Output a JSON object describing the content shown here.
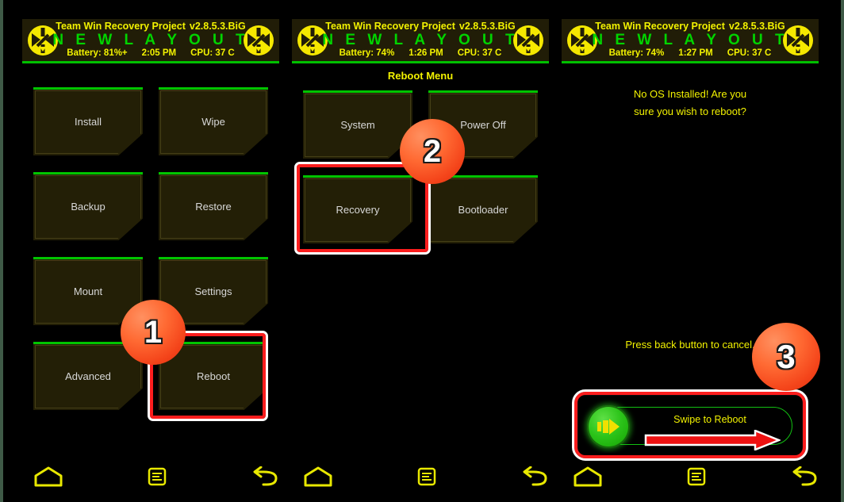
{
  "colors": {
    "background": "#000000",
    "button_fill": "#231f06",
    "button_top_border": "#00c400",
    "header_bg": "#211d07",
    "accent_yellow": "#f2f200",
    "accent_green": "#00d400",
    "highlight_red": "#fb1d1d",
    "highlight_white": "#ffffff",
    "badge_orange": "#ff6a33",
    "nav_icon_yellow": "#e8e800",
    "edge_rail": "#3f5a47"
  },
  "panels": [
    {
      "id": "panel-main-menu",
      "header": {
        "title": "Team Win Recovery Project",
        "version": "v2.8.5.3.BiG",
        "layout_banner": "N E W   L A Y O U T",
        "battery": "Battery: 81%+",
        "time": "2:05 PM",
        "cpu": "CPU: 37 C",
        "logo_left": "twrp-logo-icon",
        "logo_right": "twrp-logo-icon"
      },
      "menu_label": "",
      "buttons": [
        "Install",
        "Wipe",
        "Backup",
        "Restore",
        "Mount",
        "Settings",
        "Advanced",
        "Reboot"
      ],
      "nav": [
        "home-icon",
        "menu-icon",
        "back-icon"
      ]
    },
    {
      "id": "panel-reboot-menu",
      "header": {
        "title": "Team Win Recovery Project",
        "version": "v2.8.5.3.BiG",
        "layout_banner": "N E W   L A Y O U T",
        "battery": "Battery: 74%",
        "time": "1:26 PM",
        "cpu": "CPU: 37 C",
        "logo_left": "twrp-logo-icon",
        "logo_right": "twrp-logo-icon"
      },
      "menu_label": "Reboot Menu",
      "buttons": [
        "System",
        "Power Off",
        "Recovery",
        "Bootloader"
      ],
      "nav": [
        "home-icon",
        "menu-icon",
        "back-icon"
      ]
    },
    {
      "id": "panel-reboot-confirm",
      "header": {
        "title": "Team Win Recovery Project",
        "version": "v2.8.5.3.BiG",
        "layout_banner": "N E W   L A Y O U T",
        "battery": "Battery: 74%",
        "time": "1:27 PM",
        "cpu": "CPU: 37 C",
        "logo_left": "twrp-logo-icon",
        "logo_right": "twrp-logo-icon"
      },
      "confirm_line1": "No OS Installed! Are you",
      "confirm_line2": "sure you wish to reboot?",
      "cancel_hint": "Press back button to cancel.",
      "swipe": {
        "label": "Swipe to Reboot",
        "knob_icon": "play-forward-icon",
        "arrow_icon": "right-arrow-icon"
      },
      "nav": [
        "home-icon",
        "menu-icon",
        "back-icon"
      ]
    }
  ],
  "annotations": {
    "badges": [
      {
        "number": "1",
        "target": "reboot-button"
      },
      {
        "number": "2",
        "target": "recovery-button"
      },
      {
        "number": "3",
        "target": "swipe-to-reboot"
      }
    ],
    "highlights": [
      {
        "target": "reboot-button"
      },
      {
        "target": "recovery-button"
      },
      {
        "target": "swipe-to-reboot"
      }
    ]
  }
}
